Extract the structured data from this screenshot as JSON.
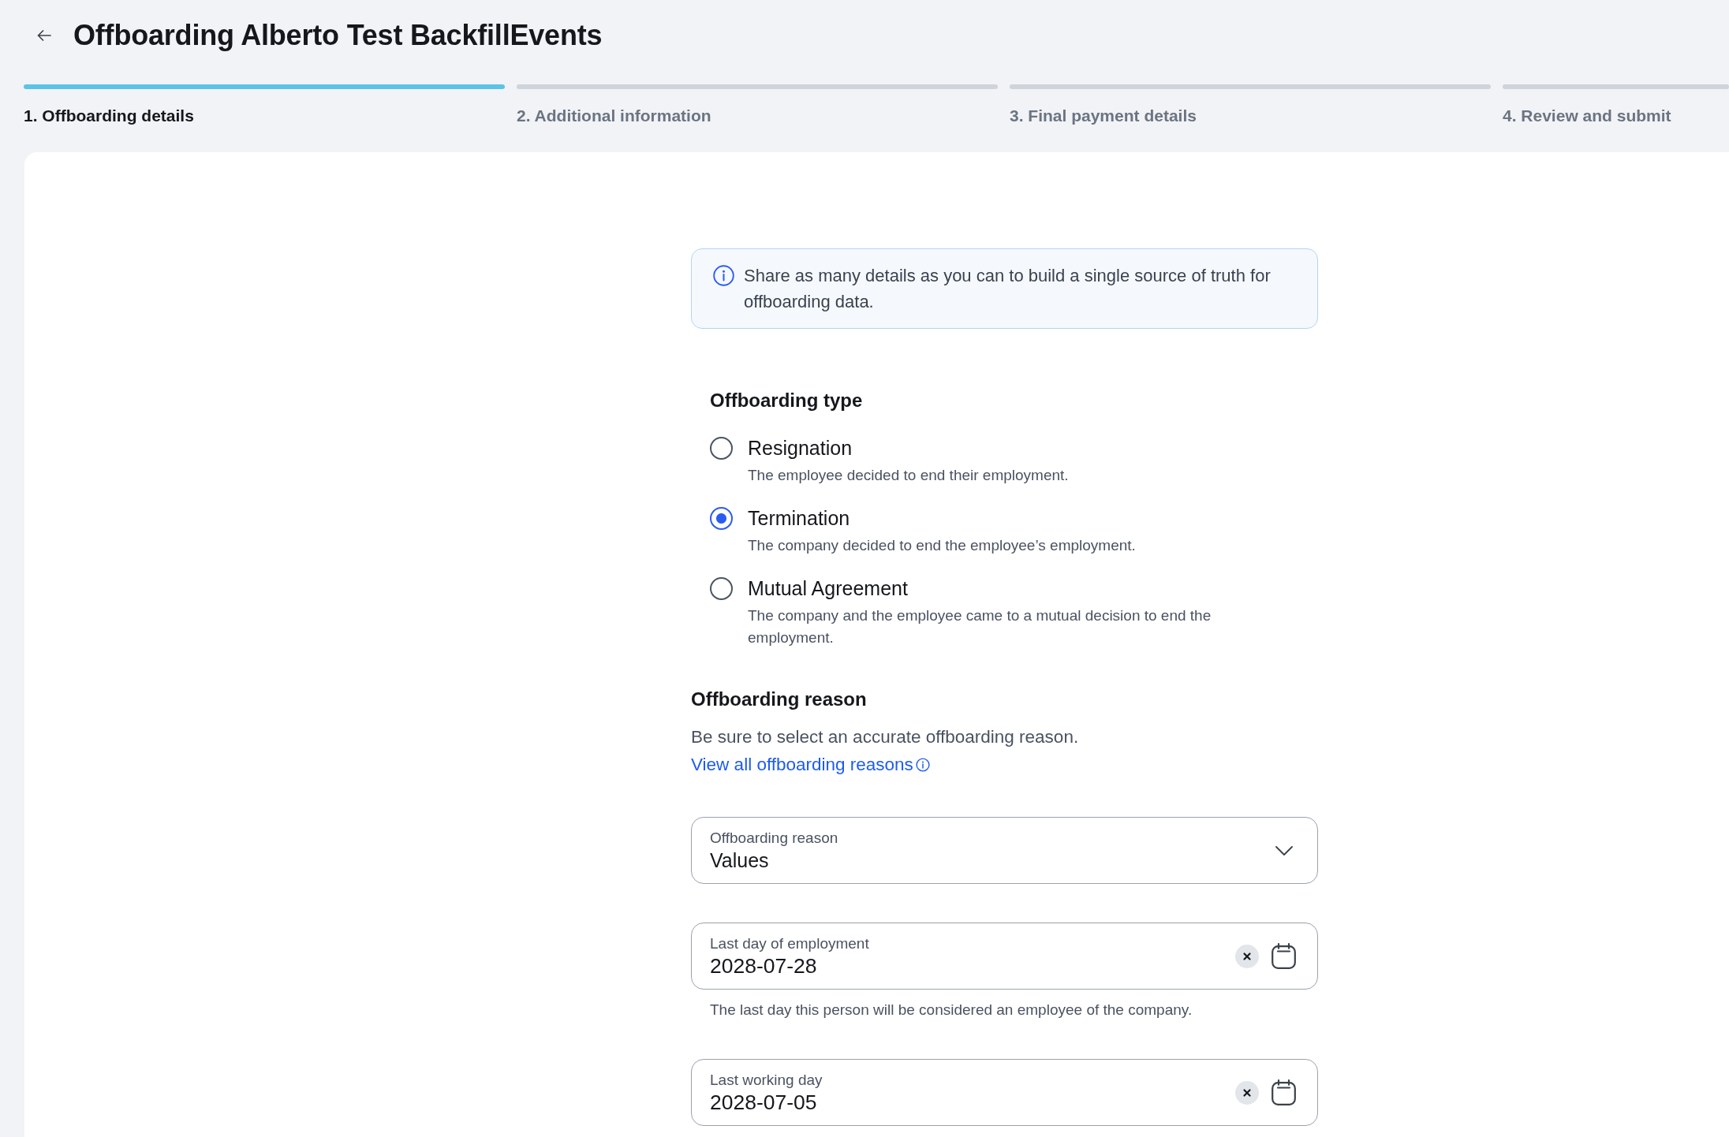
{
  "header": {
    "title": "Offboarding Alberto Test BackfillEvents"
  },
  "steps": [
    {
      "label": "1. Offboarding details",
      "selected": true
    },
    {
      "label": "2. Additional information",
      "selected": false
    },
    {
      "label": "3. Final payment details",
      "selected": false
    },
    {
      "label": "4. Review and submit",
      "selected": false
    }
  ],
  "info_banner": {
    "text": "Share as many details as you can to build a single source of truth for offboarding data."
  },
  "offboarding_type": {
    "heading": "Offboarding type",
    "options": [
      {
        "label": "Resignation",
        "description": "The employee decided to end their employment.",
        "selected": false
      },
      {
        "label": "Termination",
        "description": "The company decided to end the employee’s employment.",
        "selected": true
      },
      {
        "label": "Mutual Agreement",
        "description": "The company and the employee came to a mutual decision to end the employment.",
        "selected": false
      }
    ]
  },
  "offboarding_reason": {
    "heading": "Offboarding reason",
    "description": "Be sure to select an accurate offboarding reason.",
    "link": "View all offboarding reasons",
    "select": {
      "label": "Offboarding reason",
      "value": "Values"
    }
  },
  "date_fields": [
    {
      "label": "Last day of employment",
      "value": "2028-07-28",
      "helper": "The last day this person will be considered an employee of the company."
    },
    {
      "label": "Last working day",
      "value": "2028-07-05"
    }
  ]
}
